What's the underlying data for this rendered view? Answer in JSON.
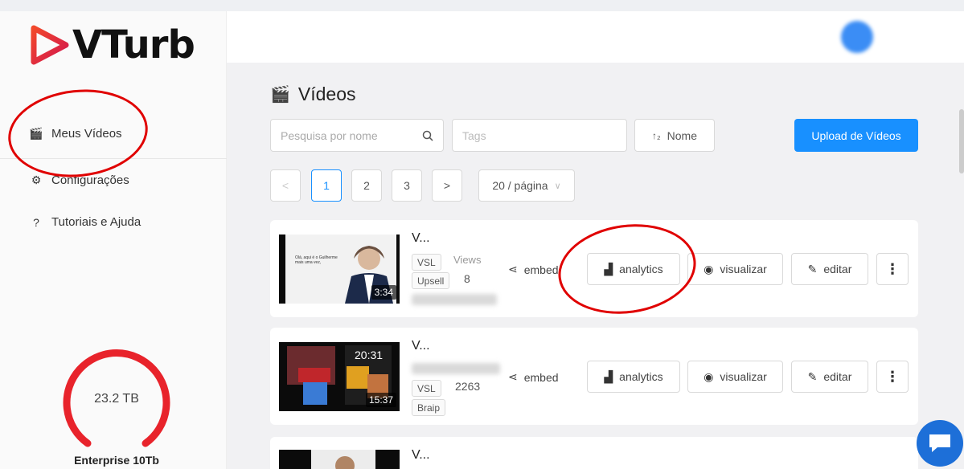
{
  "app": {
    "name": "VTurb"
  },
  "sidebar": {
    "items": [
      {
        "label": "Meus Vídeos",
        "icon": "clapperboard-icon"
      },
      {
        "label": "Configurações",
        "icon": "gear-icon"
      },
      {
        "label": "Tutoriais e Ajuda",
        "icon": "question-icon"
      }
    ],
    "storage": {
      "value": "23.2 TB",
      "plan": "Enterprise 10Tb",
      "gauge_color": "#e8232b"
    }
  },
  "header": {
    "title": "Vídeos"
  },
  "toolbar": {
    "search_placeholder": "Pesquisa por nome",
    "tags_placeholder": "Tags",
    "sort_label": "Nome",
    "upload_label": "Upload de Vídeos"
  },
  "pagination": {
    "pages": [
      "1",
      "2",
      "3"
    ],
    "current": "1",
    "page_size": "20 / página",
    "prev": "<",
    "next": ">"
  },
  "actions": {
    "embed": "embed",
    "analytics": "analytics",
    "view": "visualizar",
    "edit": "editar",
    "views_label": "Views"
  },
  "videos": [
    {
      "title": "V...",
      "duration": "3:34",
      "tags": [
        "VSL",
        "Upsell"
      ],
      "views": "8",
      "thumb_text": "Olá, aqui é o Guilherme mais uma vez,"
    },
    {
      "title": "V...",
      "duration": "15:37",
      "tags": [
        "VSL",
        "Braip"
      ],
      "views": "2263",
      "thumb_text": "20:31"
    },
    {
      "title": "V..."
    }
  ],
  "colors": {
    "accent": "#1890ff",
    "annotation": "#e00000"
  }
}
